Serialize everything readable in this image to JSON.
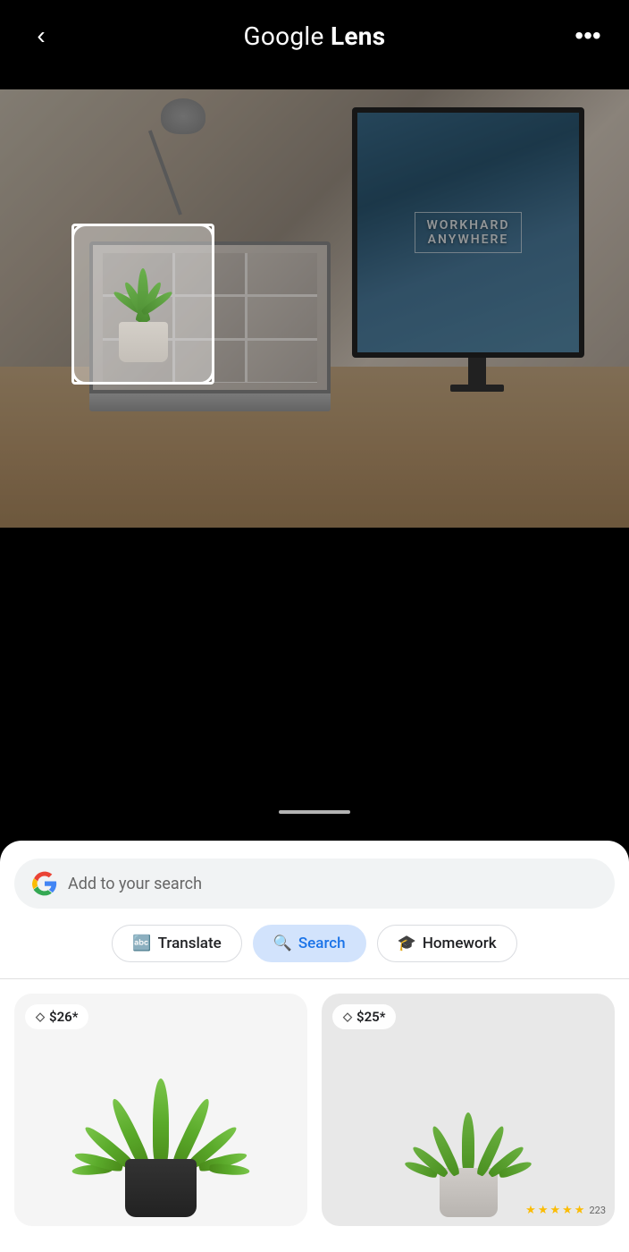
{
  "header": {
    "title_regular": "Google ",
    "title_bold": "Lens",
    "back_label": "‹",
    "more_label": "•••"
  },
  "camera": {
    "scroll_indicator": true
  },
  "monitor_text_line1": "WORKHARD",
  "monitor_text_line2": "ANYWHERE",
  "search_bar": {
    "placeholder": "Add to your search"
  },
  "pills": [
    {
      "id": "translate",
      "label": "Translate",
      "icon": "🔤",
      "active": false
    },
    {
      "id": "search",
      "label": "Search",
      "icon": "🔍",
      "active": true
    },
    {
      "id": "homework",
      "label": "Homework",
      "icon": "🎓",
      "active": false
    }
  ],
  "products": [
    {
      "id": "product-1",
      "price": "$26*",
      "alt": "Artificial agave plant in black pot",
      "stars": 0,
      "reviews": ""
    },
    {
      "id": "product-2",
      "price": "$25*",
      "alt": "Artificial agave plant in grey pot",
      "stars": 4.5,
      "reviews": "223"
    }
  ],
  "colors": {
    "active_pill_bg": "#d2e3fc",
    "active_pill_text": "#1a73e8",
    "inactive_pill_border": "#dadce0"
  }
}
